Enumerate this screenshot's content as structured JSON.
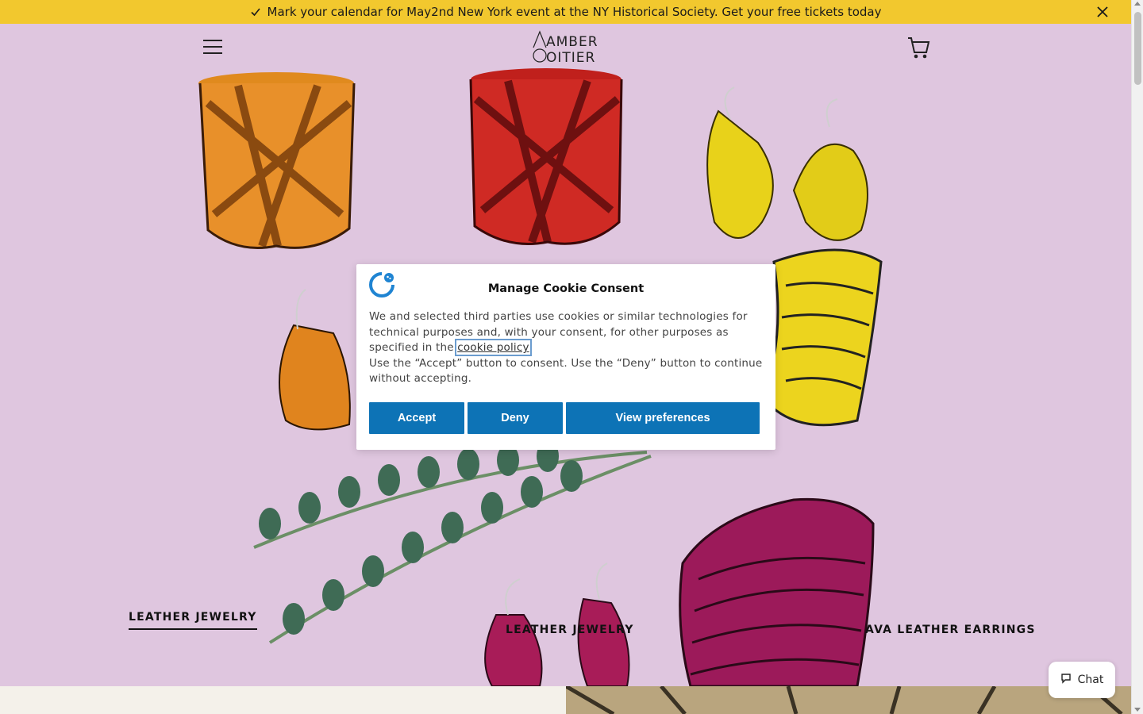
{
  "announcement": {
    "text": "Mark your calendar for May2nd New York event at the NY Historical Society. Get your free tickets today"
  },
  "header": {
    "logo_line1": "AMBER",
    "logo_line2": "OITIER"
  },
  "hero": {
    "slides": [
      {
        "label": "LEATHER JEWELRY",
        "active": true
      },
      {
        "label": "LEATHER JEWELRY",
        "active": false
      },
      {
        "label": "AVA LEATHER EARRINGS",
        "active": false
      }
    ]
  },
  "cookie_modal": {
    "title": "Manage Cookie Consent",
    "body_part1": "We and selected third parties use cookies or similar technologies for technical purposes and, with your consent, for other purposes as specified in the ",
    "policy_link": "cookie policy",
    "body_part2": "Use the “Accept” button to consent. Use the “Deny” button to continue without accepting.",
    "accept_label": "Accept",
    "deny_label": "Deny",
    "prefs_label": "View preferences"
  },
  "chat": {
    "label": "Chat"
  },
  "colors": {
    "announcement_bg": "#f2c82e",
    "hero_bg": "#dfc6df",
    "button_blue": "#0d73b6"
  }
}
